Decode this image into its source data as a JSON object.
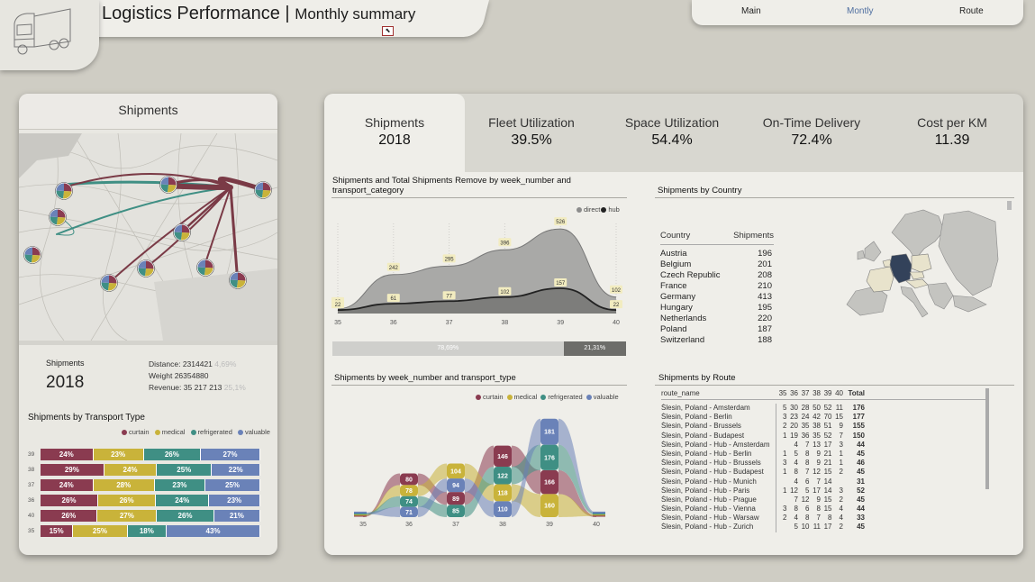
{
  "header": {
    "title": "Logistics Performance",
    "separator": " | ",
    "subtitle": "Monthly summary"
  },
  "nav": {
    "items": [
      {
        "label": "Main"
      },
      {
        "label": "Montly"
      },
      {
        "label": "Route"
      }
    ]
  },
  "colors": {
    "curtain": "#8a3b50",
    "medical": "#c9b33a",
    "refrigerated": "#3f8f84",
    "valuable": "#6a82b8",
    "route_line": "#7a3a46",
    "route_line2": "#3f8f84",
    "germany": "#33425a",
    "highlight": "#e8e3cc"
  },
  "left": {
    "title": "Shipments",
    "summary": {
      "label": "Shipments",
      "value": "2018",
      "distance_label": "Distance:",
      "distance": "2314421",
      "distance_pct": "4,69%",
      "weight_label": "Weight",
      "weight": "26354880",
      "revenue_label": "Revenue:",
      "revenue": "35 217 213",
      "revenue_pct": "25,1%"
    },
    "transport": {
      "title": "Shipments by Transport Type",
      "legend": [
        "curtain",
        "medical",
        "refrigerated",
        "valuable"
      ],
      "rows": [
        {
          "week": "39",
          "values": [
            24,
            23,
            26,
            27
          ]
        },
        {
          "week": "38",
          "values": [
            29,
            24,
            25,
            22
          ]
        },
        {
          "week": "37",
          "values": [
            24,
            28,
            23,
            25
          ]
        },
        {
          "week": "36",
          "values": [
            26,
            26,
            24,
            23
          ]
        },
        {
          "week": "40",
          "values": [
            26,
            27,
            26,
            21
          ]
        },
        {
          "week": "35",
          "values": [
            15,
            25,
            18,
            43
          ]
        }
      ]
    }
  },
  "kpis": [
    {
      "label": "Shipments",
      "value": "2018"
    },
    {
      "label": "Fleet Utilization",
      "value": "39.5%"
    },
    {
      "label": "Space Utilization",
      "value": "54.4%"
    },
    {
      "label": "On-Time Delivery",
      "value": "72.4%"
    },
    {
      "label": "Cost per KM",
      "value": "11.39"
    }
  ],
  "chart_data": [
    {
      "type": "area",
      "title": "Shipments and Total Shipments Remove by week_number and transport_category",
      "x": [
        35,
        36,
        37,
        38,
        39,
        40
      ],
      "series": [
        {
          "name": "direct",
          "values": [
            29,
            242,
            295,
            396,
            526,
            102
          ]
        },
        {
          "name": "hub",
          "values": [
            22,
            61,
            77,
            102,
            157,
            22
          ]
        }
      ],
      "split": {
        "values": [
          "78,69%",
          "21,31%"
        ]
      }
    },
    {
      "type": "bar",
      "title": "Shipments by week_number and transport_type",
      "categories": [
        35,
        36,
        37,
        38,
        39,
        40
      ],
      "series": [
        {
          "name": "curtain",
          "values": [
            null,
            80,
            89,
            146,
            166,
            null
          ]
        },
        {
          "name": "medical",
          "values": [
            null,
            78,
            104,
            118,
            160,
            null
          ]
        },
        {
          "name": "refrigerated",
          "values": [
            null,
            74,
            85,
            122,
            176,
            null
          ]
        },
        {
          "name": "valuable",
          "values": [
            null,
            71,
            94,
            110,
            181,
            null
          ]
        }
      ]
    }
  ],
  "country": {
    "title": "Shipments by Country",
    "col1": "Country",
    "col2": "Shipments",
    "rows": [
      [
        "Austria",
        "196"
      ],
      [
        "Belgium",
        "201"
      ],
      [
        "Czech Republic",
        "208"
      ],
      [
        "France",
        "210"
      ],
      [
        "Germany",
        "413"
      ],
      [
        "Hungary",
        "195"
      ],
      [
        "Netherlands",
        "220"
      ],
      [
        "Poland",
        "187"
      ],
      [
        "Switzerland",
        "188"
      ]
    ]
  },
  "route": {
    "title": "Shipments by Route",
    "col_name": "route_name",
    "weeks": [
      "35",
      "36",
      "37",
      "38",
      "39",
      "40"
    ],
    "col_total": "Total",
    "rows": [
      [
        "Ślesin, Poland - Amsterdam",
        "5",
        "30",
        "28",
        "50",
        "52",
        "11",
        "176"
      ],
      [
        "Ślesin, Poland - Berlin",
        "3",
        "23",
        "24",
        "42",
        "70",
        "15",
        "177"
      ],
      [
        "Ślesin, Poland - Brussels",
        "2",
        "20",
        "35",
        "38",
        "51",
        "9",
        "155"
      ],
      [
        "Ślesin, Poland - Budapest",
        "1",
        "19",
        "36",
        "35",
        "52",
        "7",
        "150"
      ],
      [
        "Ślesin, Poland - Hub - Amsterdam",
        "",
        "4",
        "7",
        "13",
        "17",
        "3",
        "44"
      ],
      [
        "Ślesin, Poland - Hub - Berlin",
        "1",
        "5",
        "8",
        "9",
        "21",
        "1",
        "45"
      ],
      [
        "Ślesin, Poland - Hub - Brussels",
        "3",
        "4",
        "8",
        "9",
        "21",
        "1",
        "46"
      ],
      [
        "Ślesin, Poland - Hub - Budapest",
        "1",
        "8",
        "7",
        "12",
        "15",
        "2",
        "45"
      ],
      [
        "Ślesin, Poland - Hub - Munich",
        "",
        "4",
        "6",
        "7",
        "14",
        "",
        "31"
      ],
      [
        "Ślesin, Poland - Hub - Paris",
        "1",
        "12",
        "5",
        "17",
        "14",
        "3",
        "52"
      ],
      [
        "Ślesin, Poland - Hub - Prague",
        "",
        "7",
        "12",
        "9",
        "15",
        "2",
        "45"
      ],
      [
        "Ślesin, Poland - Hub - Vienna",
        "3",
        "8",
        "6",
        "8",
        "15",
        "4",
        "44"
      ],
      [
        "Ślesin, Poland - Hub - Warsaw",
        "2",
        "4",
        "8",
        "7",
        "8",
        "4",
        "33"
      ],
      [
        "Ślesin, Poland - Hub - Zurich",
        "",
        "5",
        "10",
        "11",
        "17",
        "2",
        "45"
      ]
    ]
  }
}
